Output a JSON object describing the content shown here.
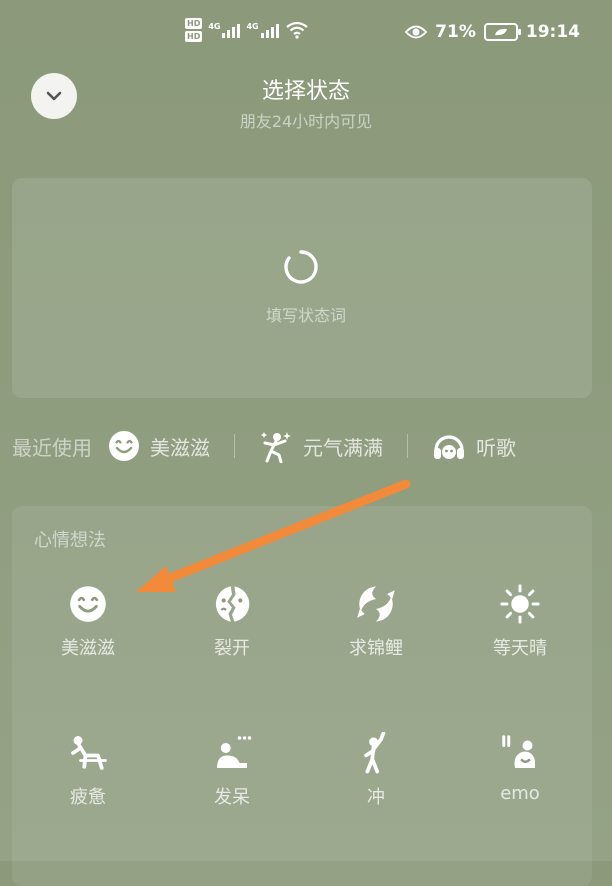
{
  "status_bar": {
    "hd1": "HD",
    "hd2": "HD",
    "net1": "4G",
    "net2": "4G",
    "battery_percent": "71%",
    "time": "19:14"
  },
  "header": {
    "title": "选择状态",
    "subtitle": "朋友24小时内可见"
  },
  "status_input": {
    "placeholder": "填写状态词"
  },
  "recent": {
    "label": "最近使用",
    "items": [
      {
        "label": "美滋滋",
        "icon": "smile-icon"
      },
      {
        "label": "元气满满",
        "icon": "energetic-icon"
      },
      {
        "label": "听歌",
        "icon": "headphones-icon"
      }
    ]
  },
  "mood_section": {
    "title": "心情想法",
    "items": [
      {
        "label": "美滋滋",
        "icon": "smile-icon"
      },
      {
        "label": "裂开",
        "icon": "cracked-icon"
      },
      {
        "label": "求锦鲤",
        "icon": "koi-icon"
      },
      {
        "label": "等天晴",
        "icon": "sun-icon"
      },
      {
        "label": "疲惫",
        "icon": "tired-icon"
      },
      {
        "label": "发呆",
        "icon": "daze-icon"
      },
      {
        "label": "冲",
        "icon": "rush-icon"
      },
      {
        "label": "emo",
        "icon": "emo-icon"
      }
    ]
  },
  "colors": {
    "background": "#8d9b7c",
    "arrow": "#f28a3a"
  }
}
